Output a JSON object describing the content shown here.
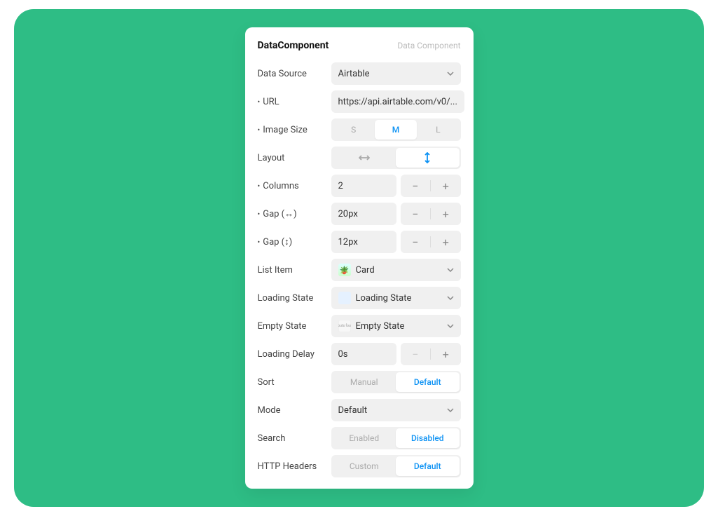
{
  "header": {
    "title": "DataComponent",
    "subtitle": "Data Component"
  },
  "dataSource": {
    "label": "Data Source",
    "value": "Airtable"
  },
  "url": {
    "label": "URL",
    "value": "https://api.airtable.com/v0/..."
  },
  "imageSize": {
    "label": "Image Size",
    "options": {
      "s": "S",
      "m": "M",
      "l": "L"
    },
    "selected": "M"
  },
  "layout": {
    "label": "Layout",
    "selected": "vertical"
  },
  "columns": {
    "label": "Columns",
    "value": "2"
  },
  "gapH": {
    "label": "Gap (↔)",
    "value": "20px"
  },
  "gapV": {
    "label": "Gap (↕)",
    "value": "12px"
  },
  "listItem": {
    "label": "List Item",
    "value": "Card"
  },
  "loadingState": {
    "label": "Loading State",
    "value": "Loading State"
  },
  "emptyState": {
    "label": "Empty State",
    "value": "Empty State"
  },
  "loadingDelay": {
    "label": "Loading Delay",
    "value": "0s"
  },
  "sort": {
    "label": "Sort",
    "options": {
      "manual": "Manual",
      "default": "Default"
    },
    "selected": "Default"
  },
  "mode": {
    "label": "Mode",
    "value": "Default"
  },
  "search": {
    "label": "Search",
    "options": {
      "enabled": "Enabled",
      "disabled": "Disabled"
    },
    "selected": "Disabled"
  },
  "httpHeaders": {
    "label": "HTTP Headers",
    "options": {
      "custom": "Custom",
      "default": "Default"
    },
    "selected": "Default"
  }
}
